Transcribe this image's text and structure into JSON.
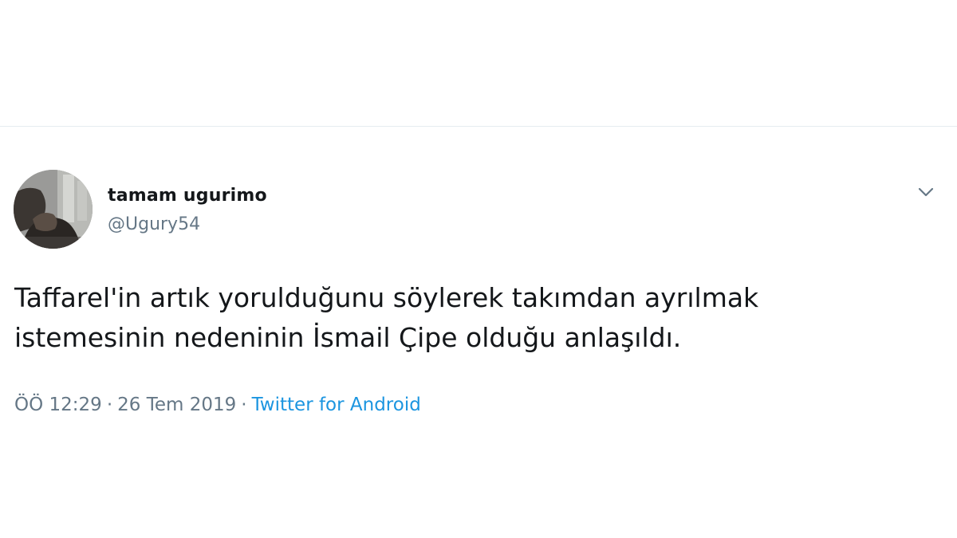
{
  "tweet": {
    "author": {
      "display_name": "tamam ugurimo",
      "handle": "@Ugury54"
    },
    "text": "Taffarel'in artık yorulduğunu söylerek takımdan ayrılmak\nistemesinin nedeninin İsmail Çipe olduğu anlaşıldı.",
    "time": "ÖÖ 12:29",
    "separator": "·",
    "date": "26 Tem 2019",
    "source": "Twitter for Android"
  },
  "icons": {
    "avatar": "avatar-photo",
    "menu": "chevron-down-icon"
  },
  "colors": {
    "text_primary": "#14171a",
    "text_secondary": "#657786",
    "link": "#1b95e0",
    "divider": "#e6ecf0"
  }
}
